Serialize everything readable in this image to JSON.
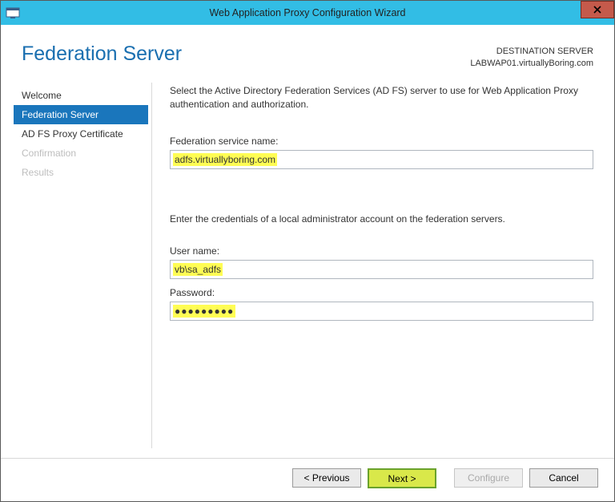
{
  "window": {
    "title": "Web Application Proxy Configuration Wizard"
  },
  "header": {
    "page_title": "Federation Server",
    "destination_label": "DESTINATION SERVER",
    "destination_value": "LABWAP01.virtuallyBoring.com"
  },
  "sidebar": {
    "steps": [
      {
        "label": "Welcome",
        "state": "enabled"
      },
      {
        "label": "Federation Server",
        "state": "active"
      },
      {
        "label": "AD FS Proxy Certificate",
        "state": "enabled"
      },
      {
        "label": "Confirmation",
        "state": "disabled"
      },
      {
        "label": "Results",
        "state": "disabled"
      }
    ]
  },
  "content": {
    "intro": "Select the Active Directory Federation Services (AD FS) server to use for Web Application Proxy authentication and authorization.",
    "federation_label": "Federation service name:",
    "federation_value": "adfs.virtuallyboring.com",
    "credentials_intro": "Enter the credentials of a local administrator account on the federation servers.",
    "username_label": "User name:",
    "username_value": "vb\\sa_adfs",
    "password_label": "Password:",
    "password_display": "●●●●●●●●●"
  },
  "footer": {
    "previous": "< Previous",
    "next": "Next >",
    "configure": "Configure",
    "cancel": "Cancel"
  }
}
